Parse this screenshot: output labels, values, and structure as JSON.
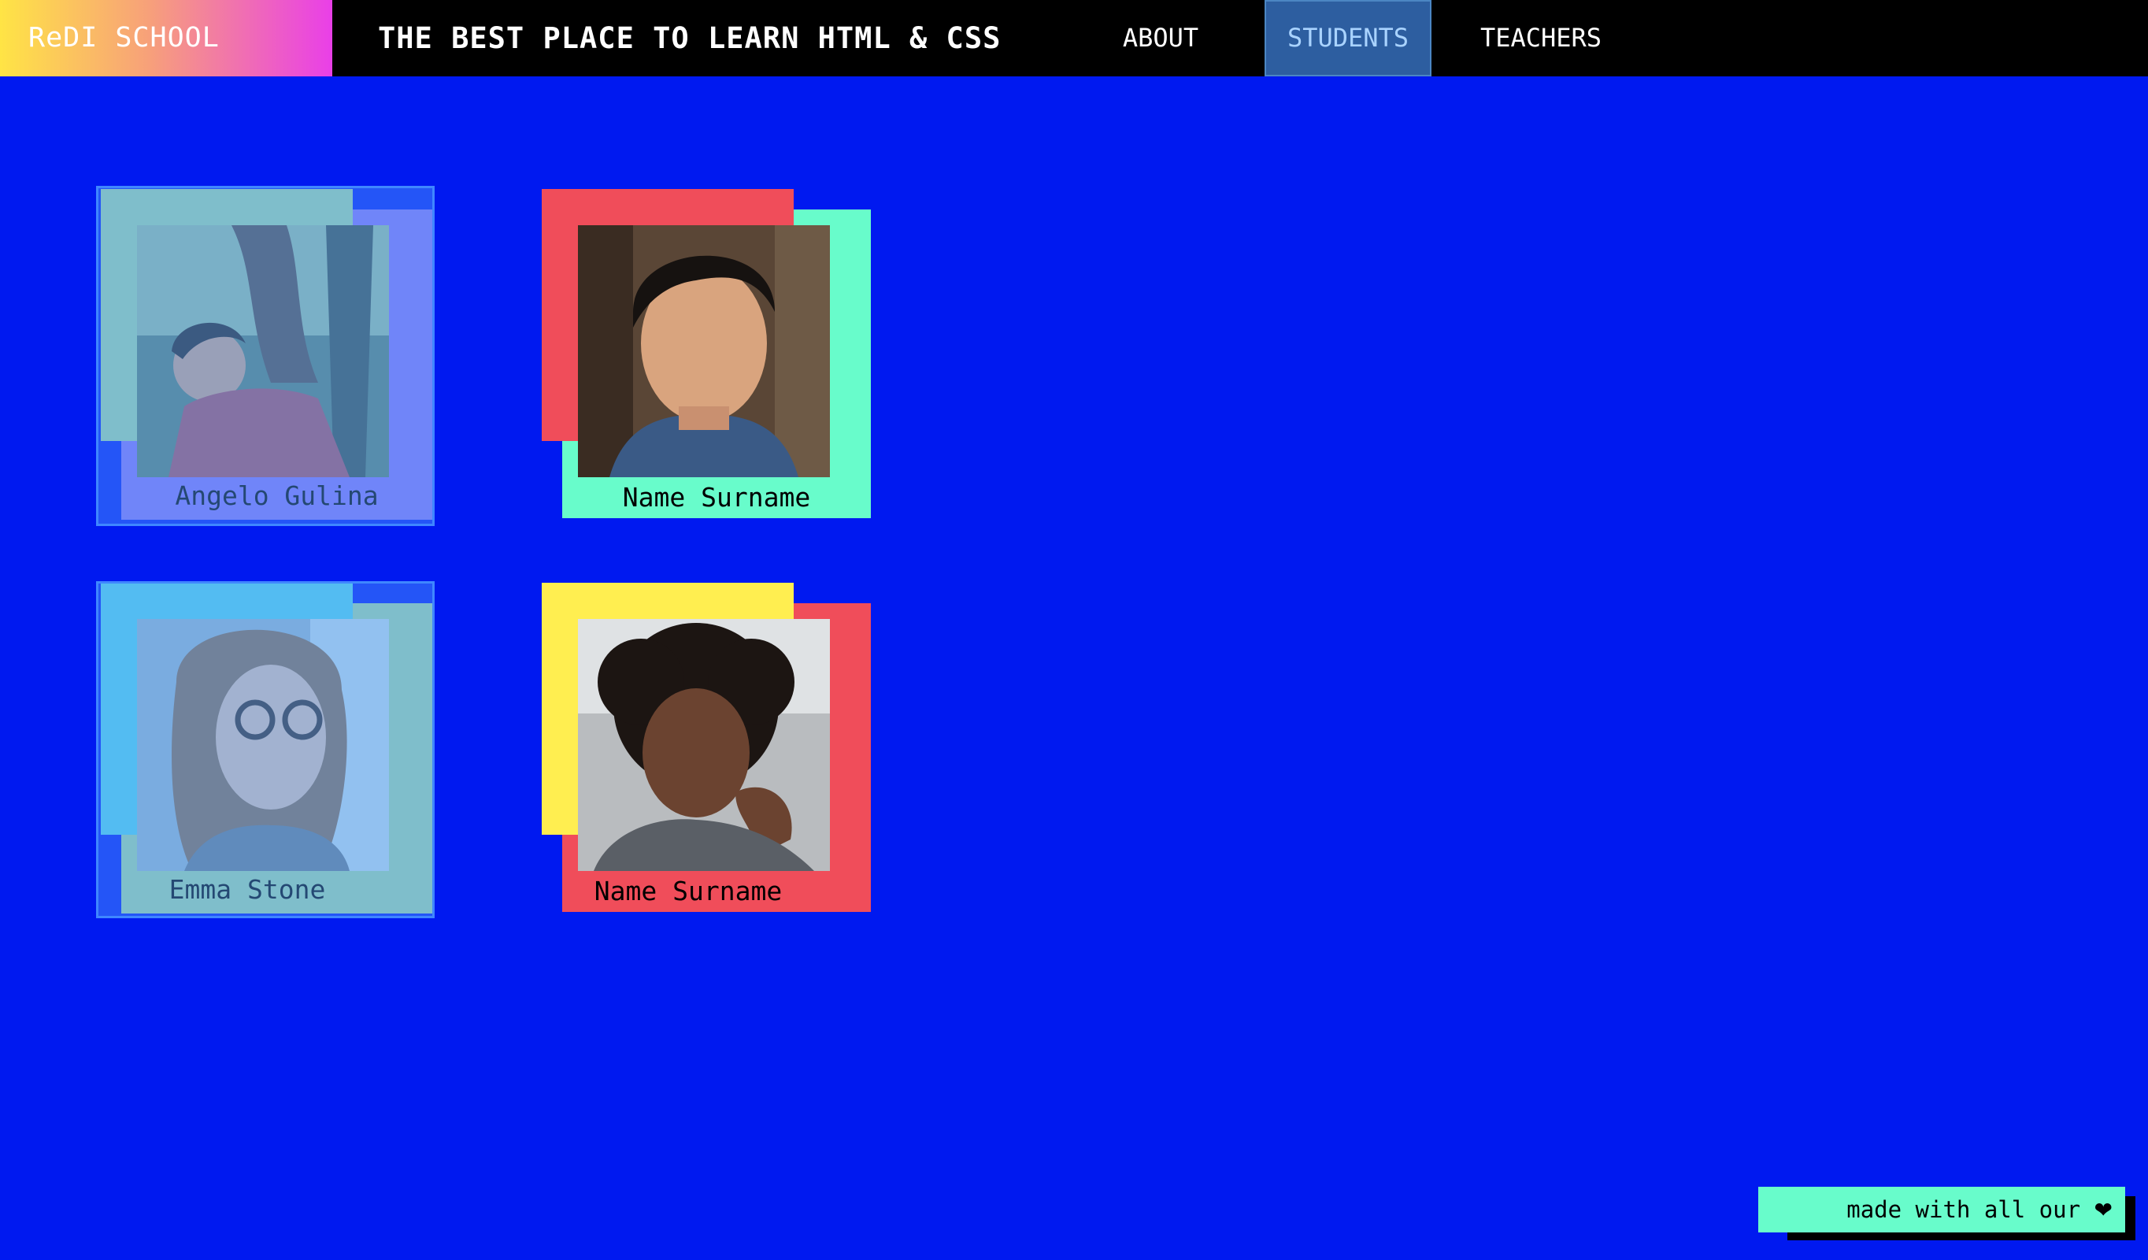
{
  "header": {
    "logo": "ReDI SCHOOL",
    "tagline": "THE BEST PLACE TO LEARN HTML & CSS",
    "nav": [
      {
        "label": "ABOUT",
        "active": false
      },
      {
        "label": "STUDENTS",
        "active": true
      },
      {
        "label": "TEACHERS",
        "active": false
      }
    ]
  },
  "cards": [
    {
      "name": "Angelo Gulina",
      "back_color": "#8b6ff4",
      "front_color": "#a7d7a0",
      "hovered": true
    },
    {
      "name": "Name Surname",
      "back_color": "#68fccb",
      "front_color": "#f04d5a",
      "hovered": false
    },
    {
      "name": "Emma Stone",
      "back_color": "#a7d7a0",
      "front_color": "#57d3e8",
      "hovered": true
    },
    {
      "name": "Name Surname",
      "back_color": "#f04d5a",
      "front_color": "#ffee50",
      "hovered": false
    }
  ],
  "footer": {
    "text": "made with all our",
    "icon": "heart-icon",
    "icon_glyph": "❤"
  },
  "colors": {
    "background": "#0019f0",
    "header": "#000000",
    "nav_active": "#2d5ea0"
  }
}
